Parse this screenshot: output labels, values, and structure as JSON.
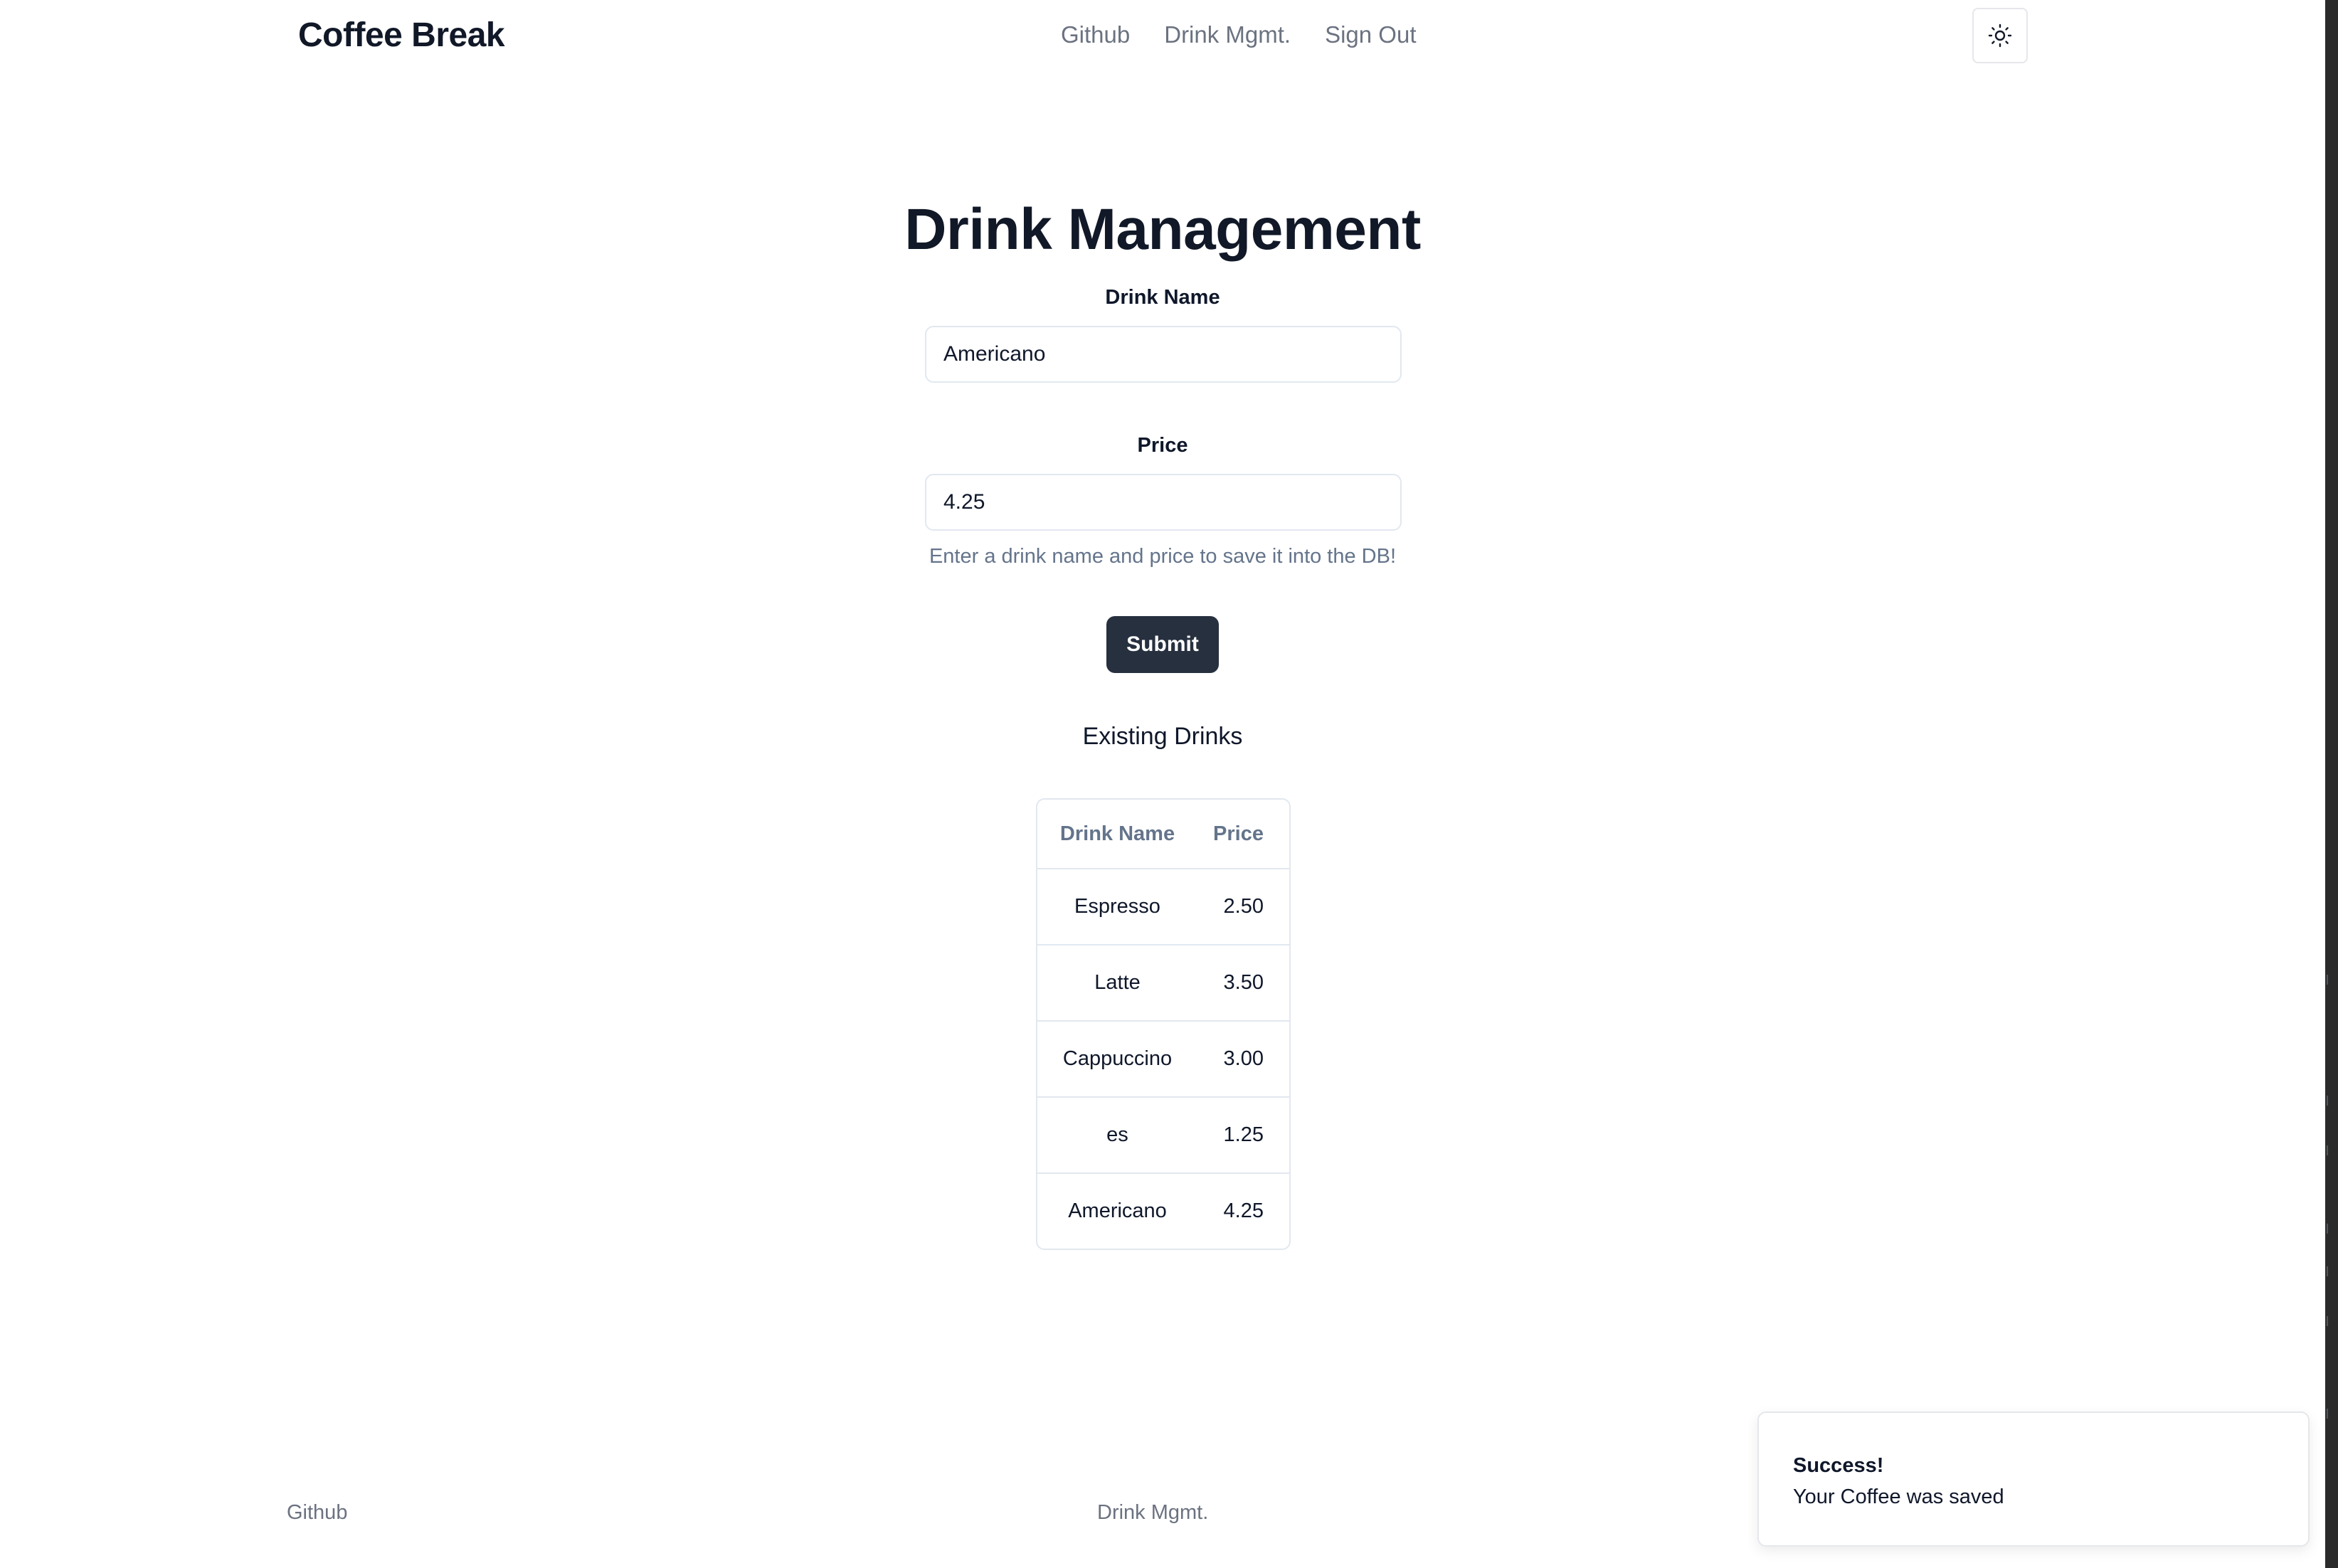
{
  "header": {
    "brand": "Coffee Break",
    "nav": [
      "Github",
      "Drink Mgmt.",
      "Sign Out"
    ],
    "theme_toggle_icon": "sun-icon"
  },
  "main": {
    "title": "Drink Management",
    "drink_name": {
      "label": "Drink Name",
      "value": "Americano"
    },
    "price": {
      "label": "Price",
      "value": "4.25"
    },
    "helper": "Enter a drink name and price to save it into the DB!",
    "submit_label": "Submit",
    "existing_title": "Existing Drinks",
    "table": {
      "headers": [
        "Drink Name",
        "Price"
      ],
      "rows": [
        [
          "Espresso",
          "2.50"
        ],
        [
          "Latte",
          "3.50"
        ],
        [
          "Cappuccino",
          "3.00"
        ],
        [
          "es",
          "1.25"
        ],
        [
          "Americano",
          "4.25"
        ]
      ]
    }
  },
  "footer": {
    "links": [
      "Github",
      "Drink Mgmt."
    ]
  },
  "toast": {
    "title": "Success!",
    "message": "Your Coffee was saved"
  },
  "colors": {
    "primary_button": "#27303f",
    "text": "#0f172a",
    "muted": "#64748b",
    "border": "#e2e8f0"
  }
}
